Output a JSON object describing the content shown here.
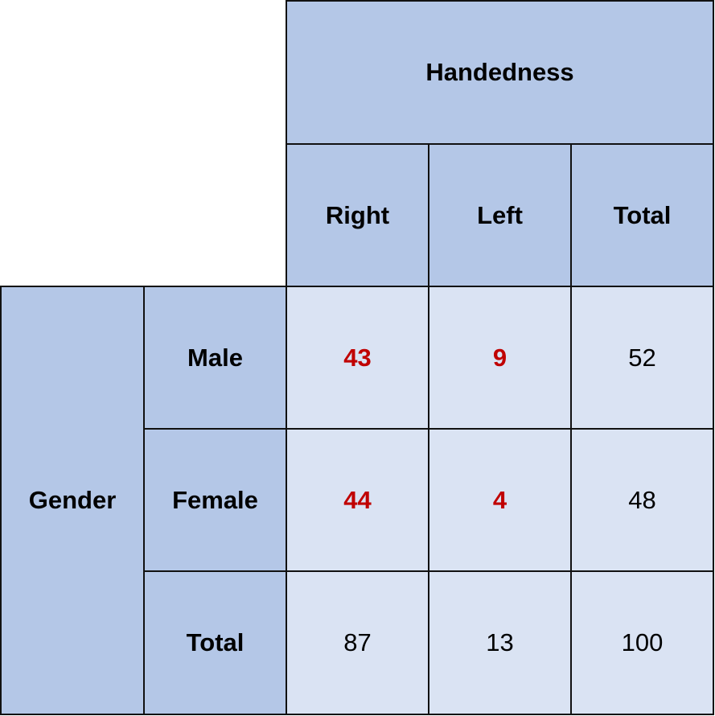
{
  "table": {
    "column_group_header": "Handedness",
    "row_group_header": "Gender",
    "column_headers": [
      "Right",
      "Left",
      "Total"
    ],
    "row_headers": [
      "Male",
      "Female",
      "Total"
    ],
    "rows": [
      [
        "43",
        "9",
        "52"
      ],
      [
        "44",
        "4",
        "48"
      ],
      [
        "87",
        "13",
        "100"
      ]
    ],
    "highlight_color": "#c00000",
    "header_fill": "#b4c7e7",
    "body_fill": "#dae3f3"
  }
}
